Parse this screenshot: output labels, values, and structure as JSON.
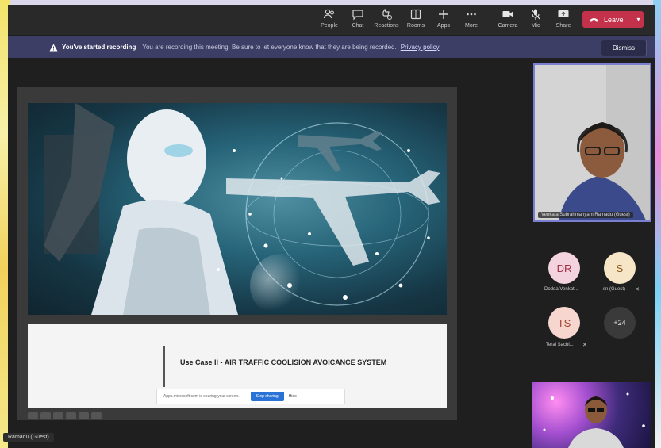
{
  "toolbar": {
    "items": [
      {
        "label": "People",
        "icon": "people-icon"
      },
      {
        "label": "Chat",
        "icon": "chat-icon"
      },
      {
        "label": "Reactions",
        "icon": "reactions-icon"
      },
      {
        "label": "Rooms",
        "icon": "rooms-icon"
      },
      {
        "label": "Apps",
        "icon": "apps-icon"
      },
      {
        "label": "More",
        "icon": "more-icon"
      },
      {
        "label": "Camera",
        "icon": "camera-icon"
      },
      {
        "label": "Mic",
        "icon": "mic-icon"
      },
      {
        "label": "Share",
        "icon": "share-icon"
      }
    ],
    "leave_label": "Leave",
    "leave_color": "#c4314b"
  },
  "banner": {
    "title": "You've started recording",
    "message": "You are recording this meeting. Be sure to let everyone know that they are being recorded.",
    "link": "Privacy policy",
    "dismiss_label": "Dismiss",
    "color": "#3d3e66"
  },
  "slide": {
    "title": "Use Case II -  AIR TRAFFIC COOLISION AVOICANCE SYSTEM",
    "share_message": "Apps.microsoft.com is sharing your screen.",
    "stop_sharing_label": "Stop sharing",
    "hide_label": "Hide"
  },
  "presenter_tag": "Ramadu (Guest)",
  "participants": {
    "main_video_caption": "Venkata Subrahmanyam Ramadu (Guest)",
    "tiles": [
      {
        "initials": "DR",
        "label": "Dodda Venkat...",
        "bg": "#f3d3dd",
        "fg": "#a0304a"
      },
      {
        "initials": "S",
        "label": "sn (Guest)",
        "bg": "#f7e5c8",
        "fg": "#8a5a1a"
      },
      {
        "initials": "TS",
        "label": "Teral Sachi...",
        "bg": "#f6d6cf",
        "fg": "#a04430"
      },
      {
        "initials": "+24",
        "label": "",
        "bg": "#3a3a3a",
        "fg": "#e0e0e0"
      }
    ]
  }
}
